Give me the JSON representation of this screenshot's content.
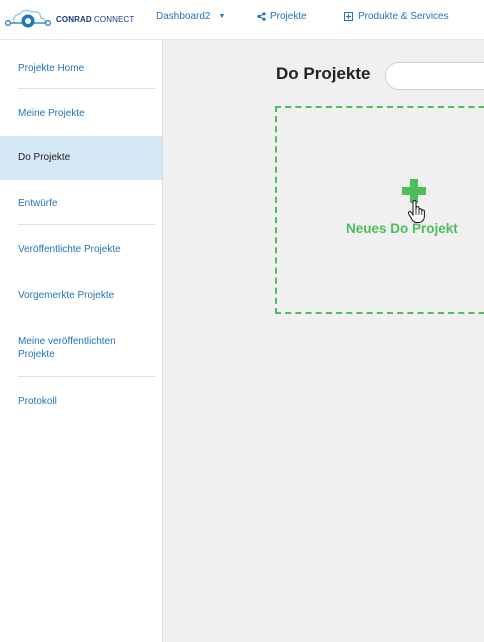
{
  "brand": {
    "name_bold": "CONRAD",
    "name_rest": "CONNECT"
  },
  "topnav": {
    "dashboard_label": "Dashboard2",
    "projects_label": "Projekte",
    "products_label": "Produkte & Services"
  },
  "sidebar": {
    "items": [
      {
        "label": "Projekte Home"
      },
      {
        "label": "Meine Projekte"
      },
      {
        "label": "Do Projekte"
      },
      {
        "label": "Entwürfe"
      },
      {
        "label": "Veröffentlichte Projekte"
      },
      {
        "label": "Vorgemerkte Projekte"
      },
      {
        "label": "Meine veröffentlichten Projekte"
      },
      {
        "label": "Protokoll"
      }
    ],
    "active_index": 2
  },
  "main": {
    "title": "Do Projekte",
    "new_project_label": "Neues Do Projekt"
  },
  "colors": {
    "accent": "#1f76b9",
    "green": "#4cbf5a",
    "active_bg": "#d5e8f5"
  }
}
